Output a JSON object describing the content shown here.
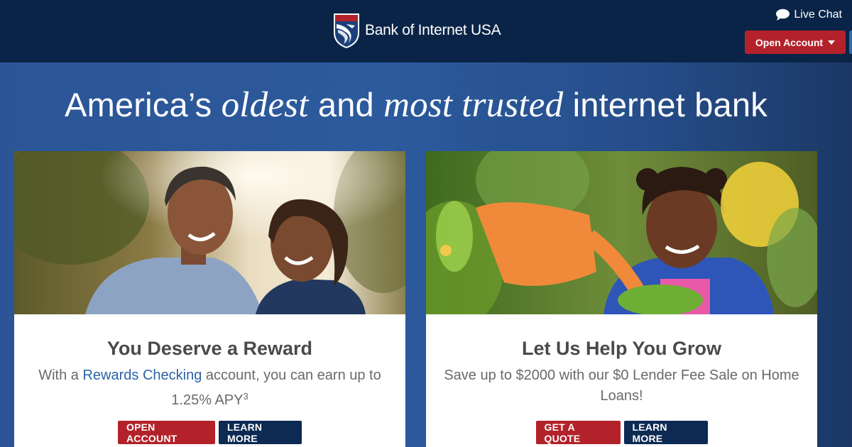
{
  "header": {
    "brand_name": "Bank of Internet USA",
    "live_chat_label": "Live Chat",
    "open_account_label": "Open Account"
  },
  "hero": {
    "headline_part1": "America’s ",
    "headline_italic1": "oldest",
    "headline_part2": " and ",
    "headline_italic2": "most trusted",
    "headline_part3": " internet bank"
  },
  "cards": [
    {
      "title": "You Deserve a Reward",
      "body_prefix": "With a ",
      "body_link": "Rewards Checking",
      "body_suffix": " account, you can earn up to 1.25% APY",
      "footnote": "3",
      "primary_button": "OPEN ACCOUNT",
      "secondary_button": "LEARN MORE"
    },
    {
      "title": "Let Us Help You Grow",
      "body": "Save up to $2000 with our $0 Lender Fee Sale on Home Loans!",
      "primary_button": "GET A QUOTE",
      "secondary_button": "LEARN MORE"
    }
  ],
  "colors": {
    "header_bg": "#0a2447",
    "hero_bg": "#2b5597",
    "accent_red": "#b3222a",
    "button_navy": "#0c2a52",
    "link_blue": "#2a63a8"
  },
  "icons": {
    "logo": "eagle-shield-logo",
    "chat": "speech-bubble-icon",
    "dropdown": "caret-down-icon"
  }
}
